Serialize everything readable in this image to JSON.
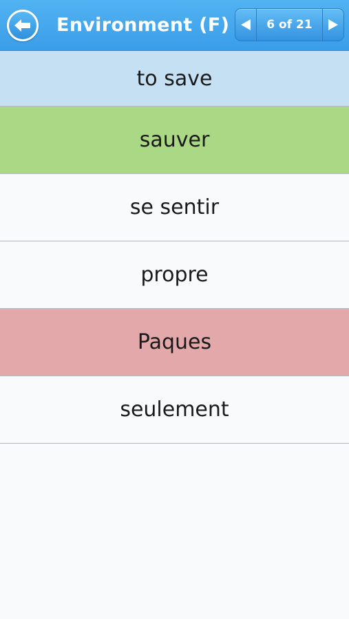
{
  "header": {
    "title": "Environment (F)",
    "back_icon": "back-arrow-icon",
    "prev_icon": "triangle-left-icon",
    "next_icon": "triangle-right-icon",
    "pager_text": "6 of 21",
    "background_color": "#3fa5ec"
  },
  "quiz": {
    "prompt": "to save",
    "options": [
      {
        "label": "sauver",
        "state": "correct"
      },
      {
        "label": "se sentir",
        "state": "neutral"
      },
      {
        "label": "propre",
        "state": "neutral"
      },
      {
        "label": "Paques",
        "state": "wrong"
      },
      {
        "label": "seulement",
        "state": "neutral"
      }
    ]
  },
  "colors": {
    "prompt": "#c4e0f2",
    "correct": "#abd884",
    "wrong": "#e2a8aa",
    "neutral": "#f9fafc"
  }
}
